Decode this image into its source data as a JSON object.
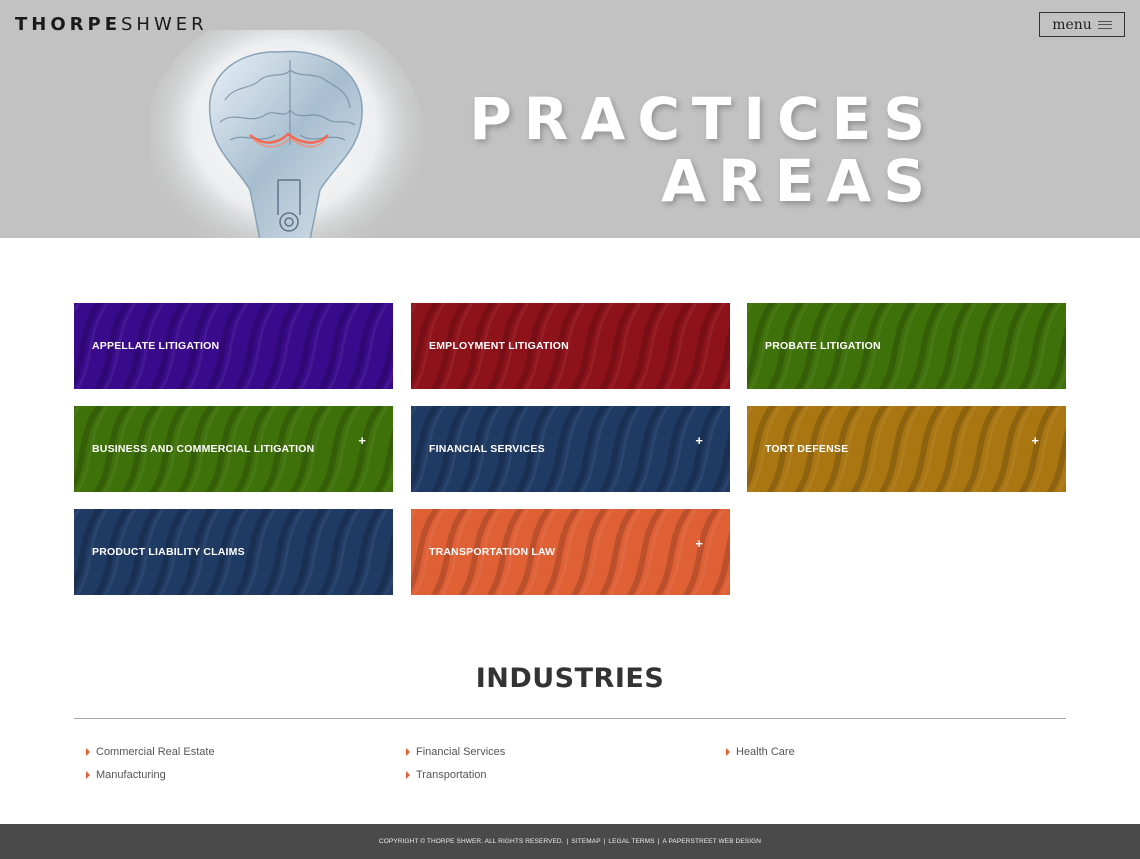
{
  "header": {
    "logo_bold": "THORPE",
    "logo_light": "SHWER",
    "menu_label": "menu"
  },
  "hero": {
    "title_line1": "PRACTICES",
    "title_line2": "AREAS"
  },
  "practices": [
    {
      "label": "APPELLATE LITIGATION",
      "color": "#3a0a8c",
      "has_plus": false
    },
    {
      "label": "EMPLOYMENT LITIGATION",
      "color": "#8e1219",
      "has_plus": false
    },
    {
      "label": "PROBATE LITIGATION",
      "color": "#3e7109",
      "has_plus": false
    },
    {
      "label": "BUSINESS AND COMMERCIAL LITIGATION",
      "color": "#3e7109",
      "has_plus": true
    },
    {
      "label": "FINANCIAL SERVICES",
      "color": "#1f3a63",
      "has_plus": true
    },
    {
      "label": "TORT DEFENSE",
      "color": "#a97612",
      "has_plus": true
    },
    {
      "label": "PRODUCT LIABILITY CLAIMS",
      "color": "#1f3a63",
      "has_plus": false
    },
    {
      "label": "TRANSPORTATION LAW",
      "color": "#e06036",
      "has_plus": true
    }
  ],
  "plus_glyph": "+",
  "industries": {
    "title": "INDUSTRIES",
    "items": [
      "Commercial Real Estate",
      "Financial Services",
      "Health Care",
      "Manufacturing",
      "Transportation"
    ]
  },
  "footer": {
    "copyright": "COPYRIGHT © THORPE SHWER. ALL RIGHTS RESERVED.",
    "sitemap": "SITEMAP",
    "legal": "LEGAL TERMS",
    "credit": "A PAPERSTREET WEB DESIGN",
    "separator": "|"
  },
  "colors": {
    "hero_bg": "#c2c2c2",
    "accent": "#e0603a",
    "footer_bg": "#4a4a4a"
  }
}
